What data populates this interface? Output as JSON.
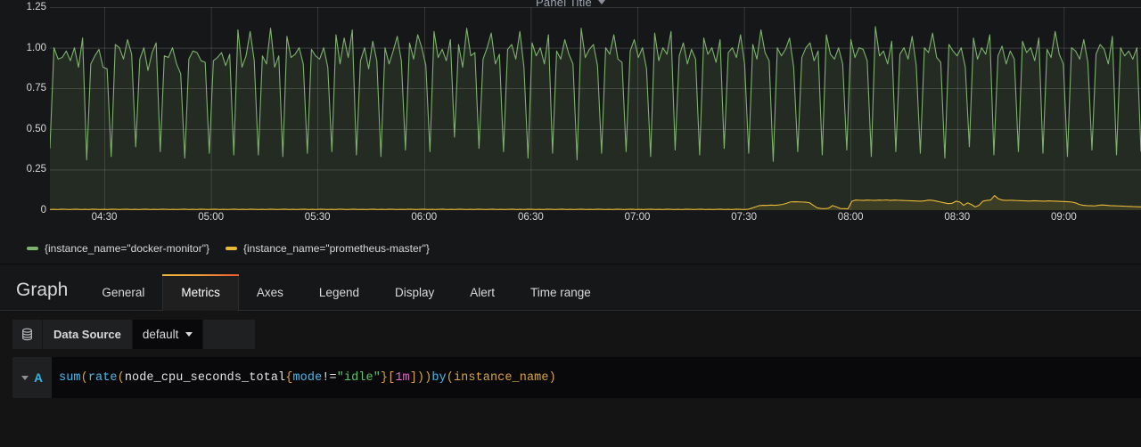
{
  "panel": {
    "title": "Panel Title",
    "title_caret_icon": "chevron-down-icon"
  },
  "chart_data": {
    "type": "line",
    "title": "Panel Title",
    "xlabel": "",
    "ylabel": "",
    "ylim": [
      0,
      1.25
    ],
    "grid": true,
    "legend_position": "bottom",
    "y_ticks": [
      "0",
      "0.25",
      "0.50",
      "0.75",
      "1.00",
      "1.25"
    ],
    "y_tick_values": [
      0,
      0.25,
      0.5,
      0.75,
      1.0,
      1.25
    ],
    "x_ticks": [
      "04:30",
      "05:00",
      "05:30",
      "06:00",
      "06:30",
      "07:00",
      "07:30",
      "08:00",
      "08:30",
      "09:00"
    ],
    "series": [
      {
        "name": "{instance_name=\"docker-monitor\"}",
        "color": "#7eb26d",
        "fill": true,
        "description": "Rapidly oscillating CPU rate hovering near 1.00 with frequent sharp dips to 0.30-0.50 across the whole window",
        "values": [
          0.38,
          1.0,
          0.93,
          0.94,
          0.98,
          0.92,
          1.0,
          0.88,
          1.06,
          0.31,
          0.9,
          0.95,
          0.99,
          0.88,
          0.87,
          0.33,
          1.02,
          1.0,
          0.93,
          1.05,
          0.96,
          0.39,
          0.93,
          1.0,
          0.86,
          0.97,
          1.03,
          0.36,
          0.95,
          0.94,
          1.0,
          0.9,
          0.84,
          0.32,
          0.93,
          0.98,
          0.97,
          0.92,
          0.91,
          0.35,
          0.92,
          0.94,
          0.97,
          0.89,
          0.96,
          0.34,
          1.11,
          0.88,
          0.95,
          1.1,
          0.92,
          0.34,
          0.95,
          0.9,
          1.12,
          0.88,
          0.95,
          0.33,
          1.07,
          0.94,
          0.96,
          1.0,
          0.9,
          0.35,
          0.99,
          0.95,
          0.93,
          1.0,
          0.88,
          0.36,
          1.08,
          0.9,
          1.06,
          0.94,
          1.11,
          0.34,
          0.92,
          1.0,
          0.87,
          1.04,
          0.92,
          0.33,
          1.0,
          0.9,
          0.98,
          1.07,
          0.92,
          0.37,
          1.03,
          0.93,
          1.08,
          1.0,
          0.89,
          0.36,
          1.1,
          0.94,
          0.99,
          0.92,
          1.05,
          0.45,
          1.02,
          0.88,
          1.12,
          0.95,
          0.97,
          0.38,
          0.93,
          1.0,
          1.09,
          0.9,
          0.96,
          0.36,
          0.99,
          1.02,
          0.93,
          1.1,
          0.88,
          0.32,
          1.03,
          0.95,
          1.0,
          0.9,
          1.08,
          0.35,
          0.98,
          0.93,
          1.05,
          0.96,
          0.9,
          0.31,
          1.12,
          0.94,
          0.99,
          1.02,
          0.89,
          0.35,
          1.0,
          0.96,
          1.08,
          0.93,
          0.91,
          0.36,
          0.98,
          1.05,
          0.94,
          1.0,
          0.87,
          0.33,
          1.09,
          0.92,
          1.0,
          0.96,
          1.1,
          0.37,
          0.95,
          1.03,
          0.9,
          0.99,
          0.93,
          0.34,
          1.06,
          0.96,
          1.0,
          0.91,
          1.05,
          0.38,
          0.97,
          1.0,
          0.94,
          1.08,
          0.9,
          0.35,
          1.02,
          0.93,
          1.11,
          0.97,
          0.92,
          0.3,
          1.0,
          0.95,
          0.99,
          1.06,
          0.88,
          0.36,
          0.94,
          1.0,
          1.03,
          0.92,
          0.98,
          0.34,
          1.08,
          0.96,
          0.93,
          1.0,
          0.9,
          0.37,
          1.05,
          0.94,
          1.0,
          0.99,
          0.92,
          0.33,
          1.13,
          0.95,
          0.98,
          0.9,
          1.04,
          0.36,
          0.96,
          1.0,
          0.93,
          1.07,
          0.89,
          0.35,
          1.0,
          0.97,
          1.09,
          0.94,
          0.91,
          0.32,
          1.02,
          0.98,
          0.95,
          1.0,
          0.88,
          0.39,
          1.06,
          0.93,
          1.0,
          0.96,
          1.08,
          0.34,
          0.95,
          1.01,
          0.9,
          0.98,
          0.93,
          0.36,
          1.04,
          0.97,
          1.0,
          0.92,
          1.06,
          0.35,
          0.99,
          0.94,
          1.1,
          0.96,
          0.9,
          0.33,
          1.0,
          0.98,
          0.93,
          1.05,
          0.91,
          0.37,
          0.96,
          1.02,
          0.99,
          0.9,
          1.07,
          0.34,
          1.0,
          0.95,
          0.98,
          0.93,
          1.0,
          0.36
        ]
      },
      {
        "name": "{instance_name=\"prometheus-master\"}",
        "color": "#eab839",
        "fill": true,
        "description": "Flat near 0 until about 08:05, then rises to roughly 0.05-0.09 with a spike near 08:45",
        "values": [
          0.004,
          0.005,
          0.004,
          0.006,
          0.005,
          0.004,
          0.005,
          0.006,
          0.004,
          0.005,
          0.004,
          0.006,
          0.005,
          0.004,
          0.005,
          0.004,
          0.006,
          0.005,
          0.004,
          0.005,
          0.006,
          0.004,
          0.005,
          0.004,
          0.005,
          0.006,
          0.004,
          0.005,
          0.004,
          0.006,
          0.005,
          0.004,
          0.005,
          0.004,
          0.005,
          0.006,
          0.004,
          0.005,
          0.004,
          0.006,
          0.005,
          0.004,
          0.005,
          0.006,
          0.004,
          0.005,
          0.004,
          0.005,
          0.006,
          0.004,
          0.005,
          0.004,
          0.006,
          0.005,
          0.004,
          0.005,
          0.004,
          0.006,
          0.005,
          0.004,
          0.005,
          0.006,
          0.004,
          0.005,
          0.004,
          0.005,
          0.006,
          0.004,
          0.005,
          0.004,
          0.006,
          0.005,
          0.004,
          0.005,
          0.004,
          0.006,
          0.005,
          0.004,
          0.005,
          0.006,
          0.004,
          0.005,
          0.004,
          0.005,
          0.006,
          0.004,
          0.005,
          0.004,
          0.006,
          0.005,
          0.004,
          0.005,
          0.004,
          0.006,
          0.005,
          0.004,
          0.005,
          0.006,
          0.004,
          0.005,
          0.004,
          0.005,
          0.006,
          0.004,
          0.005,
          0.004,
          0.006,
          0.005,
          0.004,
          0.005,
          0.004,
          0.006,
          0.005,
          0.004,
          0.005,
          0.006,
          0.004,
          0.005,
          0.004,
          0.005,
          0.006,
          0.004,
          0.005,
          0.004,
          0.006,
          0.005,
          0.004,
          0.005,
          0.004,
          0.006,
          0.005,
          0.004,
          0.005,
          0.006,
          0.004,
          0.005,
          0.004,
          0.005,
          0.006,
          0.004,
          0.005,
          0.004,
          0.006,
          0.005,
          0.004,
          0.005,
          0.004,
          0.006,
          0.005,
          0.004,
          0.005,
          0.006,
          0.004,
          0.005,
          0.004,
          0.005,
          0.006,
          0.004,
          0.005,
          0.004,
          0.006,
          0.005,
          0.004,
          0.005,
          0.004,
          0.006,
          0.005,
          0.004,
          0.005,
          0.006,
          0.004,
          0.005,
          0.004,
          0.005,
          0.006,
          0.004,
          0.005,
          0.004,
          0.006,
          0.005,
          0.004,
          0.005,
          0.012,
          0.02,
          0.028,
          0.03,
          0.029,
          0.031,
          0.03,
          0.032,
          0.035,
          0.042,
          0.05,
          0.052,
          0.051,
          0.05,
          0.049,
          0.046,
          0.03,
          0.014,
          0.01,
          0.009,
          0.012,
          0.028,
          0.02,
          0.01,
          0.009,
          0.008,
          0.055,
          0.062,
          0.061,
          0.06,
          0.062,
          0.061,
          0.06,
          0.062,
          0.061,
          0.063,
          0.06,
          0.062,
          0.061,
          0.06,
          0.059,
          0.058,
          0.057,
          0.056,
          0.055,
          0.058,
          0.062,
          0.06,
          0.055,
          0.05,
          0.045,
          0.04,
          0.042,
          0.055,
          0.05,
          0.03,
          0.045,
          0.035,
          0.02,
          0.03,
          0.055,
          0.06,
          0.062,
          0.09,
          0.07,
          0.062,
          0.06,
          0.061,
          0.06,
          0.059,
          0.058,
          0.057,
          0.056,
          0.058,
          0.057,
          0.056,
          0.055,
          0.057,
          0.056,
          0.055,
          0.054,
          0.053,
          0.052,
          0.05,
          0.045,
          0.035,
          0.03,
          0.028,
          0.027,
          0.026,
          0.03,
          0.032,
          0.03,
          0.028,
          0.027,
          0.026,
          0.025,
          0.024,
          0.023,
          0.022,
          0.021,
          0.02
        ]
      }
    ]
  },
  "legend": {
    "items": [
      {
        "label": "{instance_name=\"docker-monitor\"}",
        "color": "#7eb26d"
      },
      {
        "label": "{instance_name=\"prometheus-master\"}",
        "color": "#eab839"
      }
    ]
  },
  "editor": {
    "heading": "Graph",
    "tabs": [
      {
        "label": "General",
        "active": false
      },
      {
        "label": "Metrics",
        "active": true
      },
      {
        "label": "Axes",
        "active": false
      },
      {
        "label": "Legend",
        "active": false
      },
      {
        "label": "Display",
        "active": false
      },
      {
        "label": "Alert",
        "active": false
      },
      {
        "label": "Time range",
        "active": false
      }
    ],
    "active_tab_accent_from": "#eab839",
    "active_tab_accent_to": "#ef5b2b"
  },
  "datasource": {
    "icon": "database-icon",
    "label": "Data Source",
    "selected": "default",
    "caret_icon": "chevron-down-icon"
  },
  "query": {
    "ref_id": "A",
    "collapse_icon": "chevron-down-icon",
    "expression": "sum(rate(node_cpu_seconds_total{mode!=\"idle\"}[1m])) by (instance_name)",
    "tokens": [
      {
        "t": "sum",
        "c": "tk-fn"
      },
      {
        "t": "(",
        "c": "tk-paren"
      },
      {
        "t": "rate",
        "c": "tk-fn"
      },
      {
        "t": "(",
        "c": "tk-paren"
      },
      {
        "t": "node_cpu_seconds_total",
        "c": "tk-metric"
      },
      {
        "t": "{",
        "c": "tk-brace"
      },
      {
        "t": "mode",
        "c": "tk-label"
      },
      {
        "t": "!=",
        "c": "tk-op"
      },
      {
        "t": "\"idle\"",
        "c": "tk-str"
      },
      {
        "t": "}",
        "c": "tk-brace"
      },
      {
        "t": "[",
        "c": "tk-paren"
      },
      {
        "t": "1m",
        "c": "tk-dur"
      },
      {
        "t": "]",
        "c": "tk-paren"
      },
      {
        "t": ")",
        "c": "tk-paren"
      },
      {
        "t": ")",
        "c": "tk-paren"
      },
      {
        "t": " by ",
        "c": "tk-kw"
      },
      {
        "t": "(",
        "c": "tk-paren"
      },
      {
        "t": "instance_name",
        "c": "tk-ident"
      },
      {
        "t": ")",
        "c": "tk-paren"
      }
    ]
  }
}
